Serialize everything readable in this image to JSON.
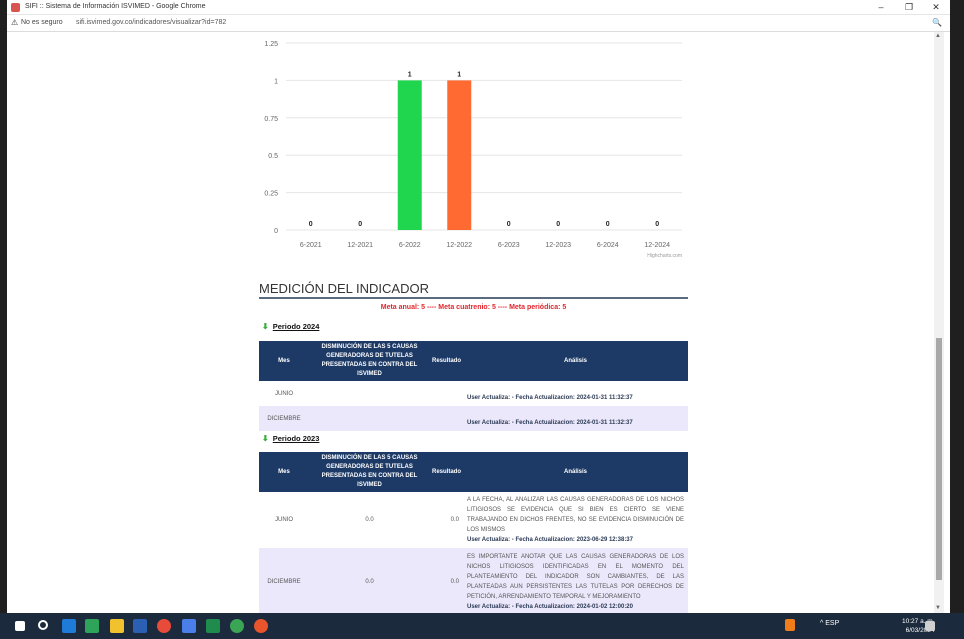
{
  "window": {
    "title": "SIFI :: Sistema de Información ISVIMED - Google Chrome",
    "minimize": "–",
    "maximize": "❐",
    "close": "✕"
  },
  "addressbar": {
    "security": "No es seguro",
    "url": "sifi.isvimed.gov.co/indicadores/visualizar?id=782"
  },
  "chart_data": {
    "type": "bar",
    "categories": [
      "6-2021",
      "12-2021",
      "6-2022",
      "12-2022",
      "6-2023",
      "12-2023",
      "6-2024",
      "12-2024"
    ],
    "values": [
      0,
      0,
      1,
      1,
      0,
      0,
      0,
      0
    ],
    "data_labels": [
      "0",
      "0",
      "1",
      "1",
      "0",
      "0",
      "0",
      "0"
    ],
    "bar_colors": [
      "#20d64f",
      "#20d64f",
      "#20d64f",
      "#ff6a33",
      "#20d64f",
      "#20d64f",
      "#20d64f",
      "#20d64f"
    ],
    "ylim": [
      0,
      1.25
    ],
    "yticks": [
      "0",
      "0.25",
      "0.5",
      "0.75",
      "1",
      "1.25"
    ],
    "grid": true,
    "credit": "Highcharts.com"
  },
  "indicator": {
    "section_title": "MEDICIÓN DEL INDICADOR",
    "meta_line": "Meta anual: 5 ---- Meta cuatrenio: 5 ---- Meta periódica: 5"
  },
  "table_headers": {
    "mes": "Mes",
    "disminucion": "DISMINUCIÓN DE LAS 5 CAUSAS GENERADORAS DE TUTELAS PRESENTADAS EN CONTRA DEL ISVIMED",
    "resultado": "Resultado",
    "analisis": "Análisis"
  },
  "periods": [
    {
      "label": "Periodo 2024",
      "rows": [
        {
          "mes": "JUNIO",
          "dis": "",
          "res": "",
          "text": "",
          "upd_label": "User Actualiza: - Fecha Actualizacion:",
          "upd_value": "2024-01-31 11:32:37"
        },
        {
          "mes": "DICIEMBRE",
          "dis": "",
          "res": "",
          "text": "",
          "upd_label": "User Actualiza: - Fecha Actualizacion:",
          "upd_value": "2024-01-31 11:32:37"
        }
      ]
    },
    {
      "label": "Periodo 2023",
      "rows": [
        {
          "mes": "JUNIO",
          "dis": "0.0",
          "res": "0.0",
          "text": "A LA FECHA, AL ANALIZAR LAS CAUSAS GENERADORAS DE LOS NICHOS LITIGIOSOS SE EVIDENCIA QUE SI BIEN ES CIERTO SE VIENE TRABAJANDO EN DICHOS FRENTES, NO SE EVIDENCIA DISMINUCIÓN DE LOS MISMOS",
          "upd_label": "User Actualiza: - Fecha Actualizacion:",
          "upd_value": "2023-06-29 12:38:37"
        },
        {
          "mes": "DICIEMBRE",
          "dis": "0.0",
          "res": "0.0",
          "text": "ES IMPORTANTE ANOTAR QUE LAS CAUSAS GENERADORAS DE LOS NICHOS LITIGIOSOS IDENTIFICADAS EN EL MOMENTO DEL PLANTEAMIENTO DEL INDICADOR SON CAMBIANTES, DE LAS PLANTEADAS AUN PERSISTENTES LAS TUTELAS POR DERECHOS DE PETICIÓN, ARRENDAMIENTO TEMPORAL Y MEJORAMIENTO",
          "upd_label": "User Actualiza: - Fecha Actualizacion:",
          "upd_value": "2024-01-02 12:00:20"
        }
      ]
    }
  ],
  "taskbar": {
    "tray_text": "^  ESP",
    "time": "10:27 a. m.",
    "date": "6/03/2024"
  },
  "colors": {
    "header_bg": "#1d3a66",
    "alt_row": "#ece8fb",
    "meta_red": "#e0262c",
    "green_bar": "#20d64f",
    "orange_bar": "#ff6a33"
  }
}
